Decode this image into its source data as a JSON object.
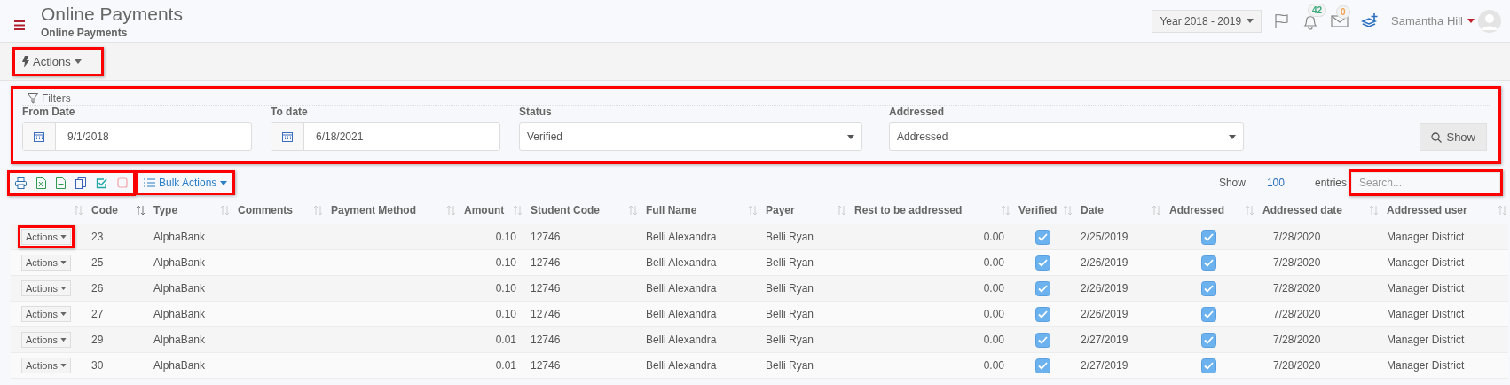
{
  "header": {
    "title": "Online Payments",
    "subtitle": "Online Payments",
    "year": "Year 2018 - 2019",
    "notifications": "42",
    "messages": "0",
    "user": "Samantha Hill"
  },
  "actions_bar": {
    "label": "Actions",
    "highlighted": true
  },
  "filters": {
    "title": "Filters",
    "highlighted": true,
    "fields": [
      {
        "label": "From Date",
        "kind": "date",
        "value": "9/1/2018"
      },
      {
        "label": "To date",
        "kind": "date",
        "value": "6/18/2021"
      },
      {
        "label": "Status",
        "kind": "select",
        "value": "Verified"
      },
      {
        "label": "Addressed",
        "kind": "select",
        "value": "Addressed"
      }
    ],
    "button": "Show"
  },
  "toolbar": {
    "highlighted": true,
    "export_icons": [
      {
        "kind": "print"
      },
      {
        "kind": "excel"
      },
      {
        "kind": "csv"
      },
      {
        "kind": "copy"
      },
      {
        "kind": "select"
      },
      {
        "kind": "deselect"
      }
    ],
    "bulk_actions": {
      "label": "Bulk Actions",
      "highlighted": true
    },
    "show": "Show",
    "entries_count": "100",
    "entries": "entries",
    "search": {
      "placeholder": "Search...",
      "highlighted": true
    }
  },
  "table": {
    "columns": [
      {
        "sorted": false
      },
      {
        "label": "Code",
        "sorted": true
      },
      {
        "label": "Type",
        "sorted": false
      },
      {
        "label": "Comments",
        "sorted": false
      },
      {
        "label": "Payment Method",
        "sorted": false
      },
      {
        "label": "Amount",
        "sorted": false
      },
      {
        "label": "Student Code",
        "sorted": false
      },
      {
        "label": "Full Name",
        "sorted": false
      },
      {
        "label": "Payer",
        "sorted": false
      },
      {
        "label": "Rest to be addressed",
        "sorted": false
      },
      {
        "label": "Verified",
        "sorted": false
      },
      {
        "label": "Date",
        "sorted": false
      },
      {
        "label": "Addressed",
        "sorted": false
      },
      {
        "label": "Addressed date",
        "sorted": false
      },
      {
        "label": "Addressed user",
        "sorted": false
      }
    ],
    "rows": [
      {
        "action": "Actions",
        "highlighted": true,
        "code": "23",
        "type": "AlphaBank",
        "amount": "0.10",
        "student_code": "12746",
        "full_name": "Belli Alexandra",
        "payer": "Belli Ryan",
        "rest": "0.00",
        "verified": true,
        "date": "2/25/2019",
        "addressed": true,
        "addressed_date": "7/28/2020",
        "addressed_user": "Manager District"
      },
      {
        "action": "Actions",
        "highlighted": false,
        "code": "25",
        "type": "AlphaBank",
        "amount": "0.10",
        "student_code": "12746",
        "full_name": "Belli Alexandra",
        "payer": "Belli Ryan",
        "rest": "0.00",
        "verified": true,
        "date": "2/26/2019",
        "addressed": true,
        "addressed_date": "7/28/2020",
        "addressed_user": "Manager District"
      },
      {
        "action": "Actions",
        "highlighted": false,
        "code": "26",
        "type": "AlphaBank",
        "amount": "0.10",
        "student_code": "12746",
        "full_name": "Belli Alexandra",
        "payer": "Belli Ryan",
        "rest": "0.00",
        "verified": true,
        "date": "2/26/2019",
        "addressed": true,
        "addressed_date": "7/28/2020",
        "addressed_user": "Manager District"
      },
      {
        "action": "Actions",
        "highlighted": false,
        "code": "27",
        "type": "AlphaBank",
        "amount": "0.10",
        "student_code": "12746",
        "full_name": "Belli Alexandra",
        "payer": "Belli Ryan",
        "rest": "0.00",
        "verified": true,
        "date": "2/26/2019",
        "addressed": true,
        "addressed_date": "7/28/2020",
        "addressed_user": "Manager District"
      },
      {
        "action": "Actions",
        "highlighted": false,
        "code": "29",
        "type": "AlphaBank",
        "amount": "0.01",
        "student_code": "12746",
        "full_name": "Belli Alexandra",
        "payer": "Belli Ryan",
        "rest": "0.00",
        "verified": true,
        "date": "2/27/2019",
        "addressed": true,
        "addressed_date": "7/28/2020",
        "addressed_user": "Manager District"
      },
      {
        "action": "Actions",
        "highlighted": false,
        "code": "30",
        "type": "AlphaBank",
        "amount": "0.01",
        "student_code": "12746",
        "full_name": "Belli Alexandra",
        "payer": "Belli Ryan",
        "rest": "0.00",
        "verified": true,
        "date": "2/27/2019",
        "addressed": true,
        "addressed_date": "7/28/2020",
        "addressed_user": "Manager District"
      }
    ]
  }
}
